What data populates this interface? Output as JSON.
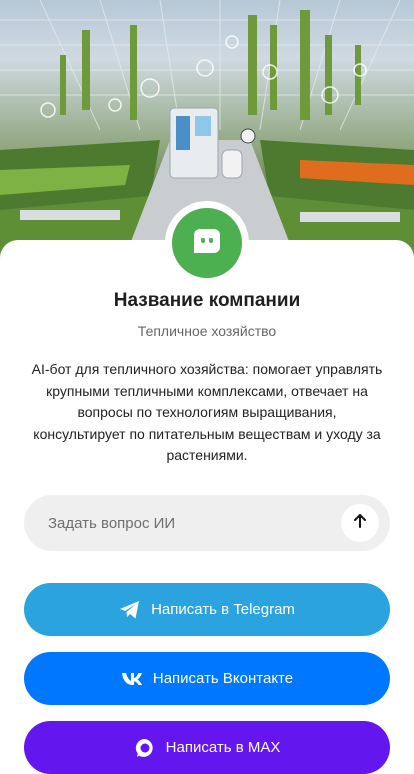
{
  "hero": {
    "image": "greenhouse-robot-illustration"
  },
  "company": {
    "avatar_icon": "chat-bot-icon",
    "name": "Название компании",
    "category": "Тепличное хозяйство",
    "description": "AI-бот для тепличного хозяйства: помогает управлять крупными тепличными комплексами, отвечает на вопросы по технологиям выращивания, консультирует по питательным веществам и уходу за растениями."
  },
  "ask": {
    "placeholder": "Задать вопрос ИИ",
    "send_icon": "arrow-up-icon"
  },
  "buttons": {
    "telegram": {
      "label": "Написать в Telegram",
      "icon": "telegram-icon",
      "color": "#2aa3df"
    },
    "vk": {
      "label": "Написать Вконтакте",
      "icon": "vk-icon",
      "color": "#0077ff"
    },
    "max": {
      "label": "Написать в MAX",
      "icon": "max-icon",
      "color": "#6416ee"
    }
  },
  "colors": {
    "avatar": "#4caf50",
    "input_bg": "#efefef"
  }
}
